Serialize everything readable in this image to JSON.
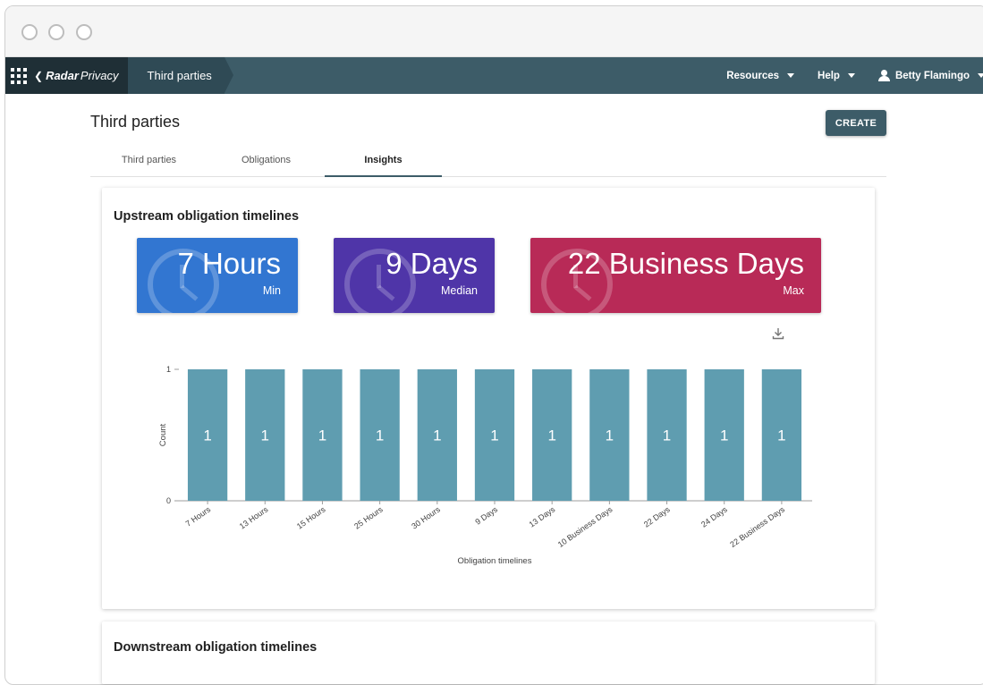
{
  "nav": {
    "brand_radar": "Radar",
    "brand_privacy": "Privacy",
    "breadcrumb": "Third parties",
    "resources_label": "Resources",
    "help_label": "Help",
    "user_name": "Betty Flamingo"
  },
  "page": {
    "title": "Third parties",
    "create_label": "CREATE"
  },
  "tabs": [
    {
      "label": "Third parties",
      "active": false
    },
    {
      "label": "Obligations",
      "active": false
    },
    {
      "label": "Insights",
      "active": true
    }
  ],
  "upstream": {
    "title": "Upstream obligation timelines",
    "stats": [
      {
        "value": "7 Hours",
        "label": "Min",
        "color": "#3276d1"
      },
      {
        "value": "9 Days",
        "label": "Median",
        "color": "#4f35a8"
      },
      {
        "value": "22 Business Days",
        "label": "Max",
        "color": "#b82a57"
      }
    ]
  },
  "downstream": {
    "title": "Downstream obligation timelines"
  },
  "chart_data": {
    "type": "bar",
    "categories": [
      "7 Hours",
      "13 Hours",
      "15 Hours",
      "25 Hours",
      "30 Hours",
      "9 Days",
      "13 Days",
      "10 Business Days",
      "22 Days",
      "24 Days",
      "22 Business Days"
    ],
    "values": [
      1,
      1,
      1,
      1,
      1,
      1,
      1,
      1,
      1,
      1,
      1
    ],
    "xlabel": "Obligation timelines",
    "ylabel": "Count",
    "ylim": [
      0,
      1
    ],
    "yticks": [
      0,
      1
    ],
    "bar_color": "#5f9db0",
    "grid": false
  }
}
